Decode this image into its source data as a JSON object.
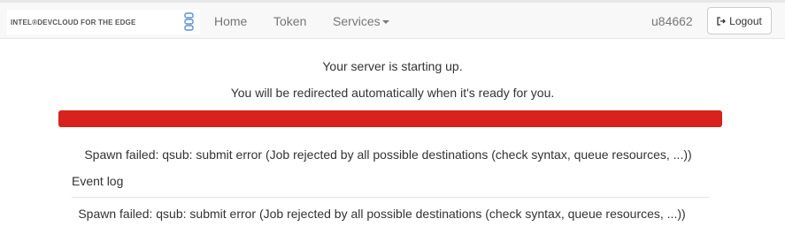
{
  "navbar": {
    "brand": "INTEL®DEVCLOUD FOR THE EDGE",
    "links": [
      {
        "label": "Home"
      },
      {
        "label": "Token"
      },
      {
        "label": "Services"
      }
    ],
    "user": "u84662",
    "logout_label": "Logout"
  },
  "main": {
    "status_message": "Your server is starting up.",
    "redirect_message": "You will be redirected automatically when it's ready for you.",
    "progress": {
      "percent": 100,
      "color": "#d9211e",
      "state": "failed"
    },
    "spawn_error": "Spawn failed: qsub: submit error (Job rejected by all possible destinations (check syntax, queue resources, ...))",
    "event_log": {
      "title": "Event log",
      "entries": [
        "Spawn failed: qsub: submit error (Job rejected by all possible destinations (check syntax, queue resources, ...))"
      ]
    }
  },
  "icons": {
    "brand": "devcloud-logo-icon",
    "services_dropdown": "caret-down-icon",
    "logout": "sign-out-icon"
  }
}
